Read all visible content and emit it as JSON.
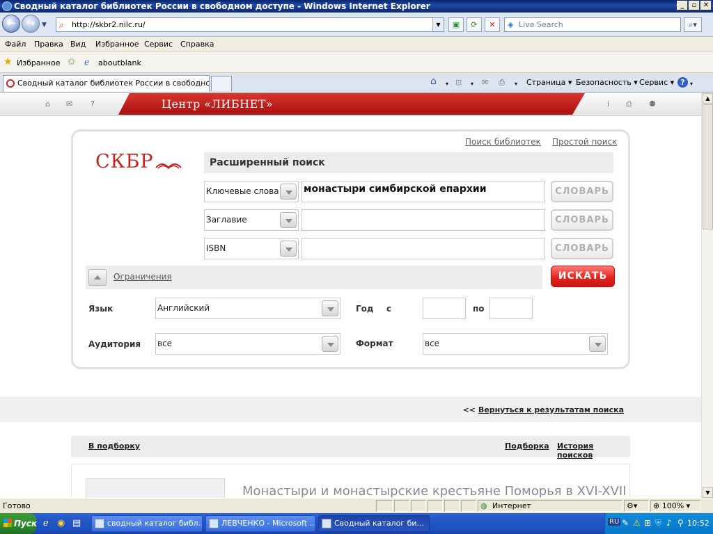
{
  "window": {
    "title": "Сводный каталог библиотек России в свободном доступе - Windows Internet Explorer",
    "minimize": "_",
    "maximize": "▫",
    "close": "✕"
  },
  "addressbar": {
    "url": "http://skbr2.nilc.ru/",
    "search_placeholder": "Live Search"
  },
  "menu": [
    "Файл",
    "Правка",
    "Вид",
    "Избранное",
    "Сервис",
    "Справка"
  ],
  "favorites": {
    "label": "Избранное",
    "link": "aboutblank"
  },
  "tab": {
    "title": "Сводный каталог библиотек России в свободном ..."
  },
  "commandbar": {
    "page": "Страница",
    "safety": "Безопасность",
    "tools": "Сервис"
  },
  "site": {
    "brand": "Центр «ЛИБНЕТ»",
    "header_icons": [
      "home-icon",
      "mail-icon",
      "help-icon",
      "info-icon",
      "print-icon",
      "people-icon"
    ]
  },
  "panel": {
    "link_libraries": "Поиск библиотек",
    "link_simple": "Простой поиск",
    "logo": "СКБР",
    "heading": "Расширенный поиск",
    "rows": [
      {
        "field": "Ключевые слова",
        "value": "монастыри симбирской епархии",
        "dict": "СЛОВАРЬ"
      },
      {
        "field": "Заглавие",
        "value": "",
        "dict": "СЛОВАРЬ"
      },
      {
        "field": "ISBN",
        "value": "",
        "dict": "СЛОВАРЬ"
      }
    ],
    "limits_label": "Ограничения",
    "search_button": "ИСКАТЬ",
    "language_label": "Язык",
    "language_value": "Английский",
    "year_label": "Год",
    "year_from": "с",
    "year_to": "по",
    "audience_label": "Аудитория",
    "audience_value": "все",
    "format_label": "Формат",
    "format_value": "все"
  },
  "results": {
    "back_prefix": "<<",
    "back_link": "Вернуться к результатам поиска",
    "to_selection": "В подборку",
    "selection": "Подборка",
    "history": "История поисков",
    "first_title": "Монастыри и монастырские крестьяне Поморья в XVI-XVII"
  },
  "statusbar": {
    "status": "Готово",
    "zone": "Интернет",
    "zoom": "100%"
  },
  "taskbar": {
    "start": "Пуск",
    "tasks": [
      "сводный каталог библ...",
      "ЛЕВЧЕНКО - Microsoft ...",
      "Сводный каталог би..."
    ],
    "lang": "RU",
    "time": "10:52"
  }
}
